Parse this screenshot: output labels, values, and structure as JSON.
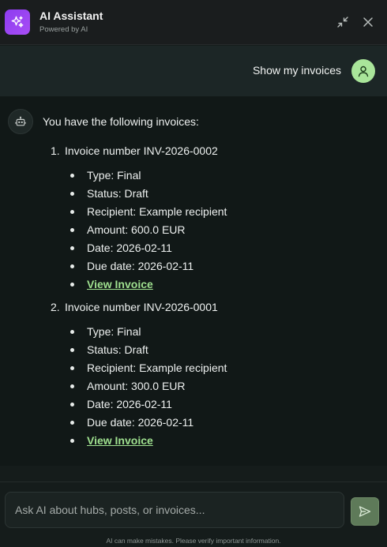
{
  "header": {
    "title": "AI Assistant",
    "subtitle": "Powered by AI",
    "logo_icon": "sparkles-icon",
    "minimize_icon": "minimize-icon",
    "close_icon": "close-icon",
    "brand_color": "#9b45f2"
  },
  "user_message": {
    "text": "Show my invoices",
    "avatar_icon": "user-icon"
  },
  "bot_message": {
    "avatar_icon": "bot-icon",
    "intro": "You have the following invoices:",
    "invoices": [
      {
        "index": "1.",
        "title": "Invoice number INV-2026-0002",
        "details": [
          "Type: Final",
          "Status: Draft",
          "Recipient: Example recipient",
          "Amount: 600.0 EUR",
          "Date: 2026-02-11",
          "Due date: 2026-02-11"
        ],
        "link": "View Invoice"
      },
      {
        "index": "2.",
        "title": "Invoice number INV-2026-0001",
        "details": [
          "Type: Final",
          "Status: Draft",
          "Recipient: Example recipient",
          "Amount: 300.0 EUR",
          "Date: 2026-02-11",
          "Due date: 2026-02-11"
        ],
        "link": "View Invoice"
      }
    ]
  },
  "composer": {
    "placeholder": "Ask AI about hubs, posts, or invoices...",
    "value": "",
    "send_icon": "send-icon",
    "disclaimer": "AI can make mistakes. Please verify important information."
  },
  "colors": {
    "accent_green": "#9fe08f",
    "send_button": "#5e7a59"
  }
}
